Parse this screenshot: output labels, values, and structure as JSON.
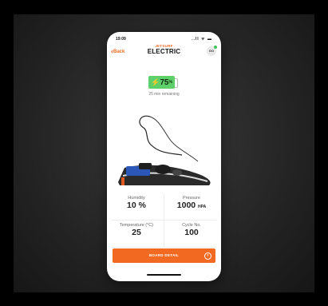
{
  "status_bar": {
    "time": "19:09",
    "icons": "..ll ᯤ ▬"
  },
  "header": {
    "back_label": "Back",
    "brand_top": "JETSURF",
    "brand_main": "ELECTRIC",
    "avatar_initials": "GO"
  },
  "battery": {
    "value": "75",
    "unit": "%",
    "remaining": "25 min remaining"
  },
  "stats": {
    "humidity": {
      "label": "Humidity",
      "value": "10 %",
      "unit": ""
    },
    "pressure": {
      "label": "Pressure",
      "value": "1000",
      "unit": "HPA"
    },
    "temperature": {
      "label": "Temperature (°C)",
      "value": "25",
      "unit": ""
    },
    "cycle": {
      "label": "Cycle No.",
      "value": "100",
      "unit": ""
    }
  },
  "action_button": {
    "label": "BOARD DETAIL"
  },
  "colors": {
    "accent": "#f26a21",
    "battery": "#5ed06a",
    "background": "#000000"
  }
}
